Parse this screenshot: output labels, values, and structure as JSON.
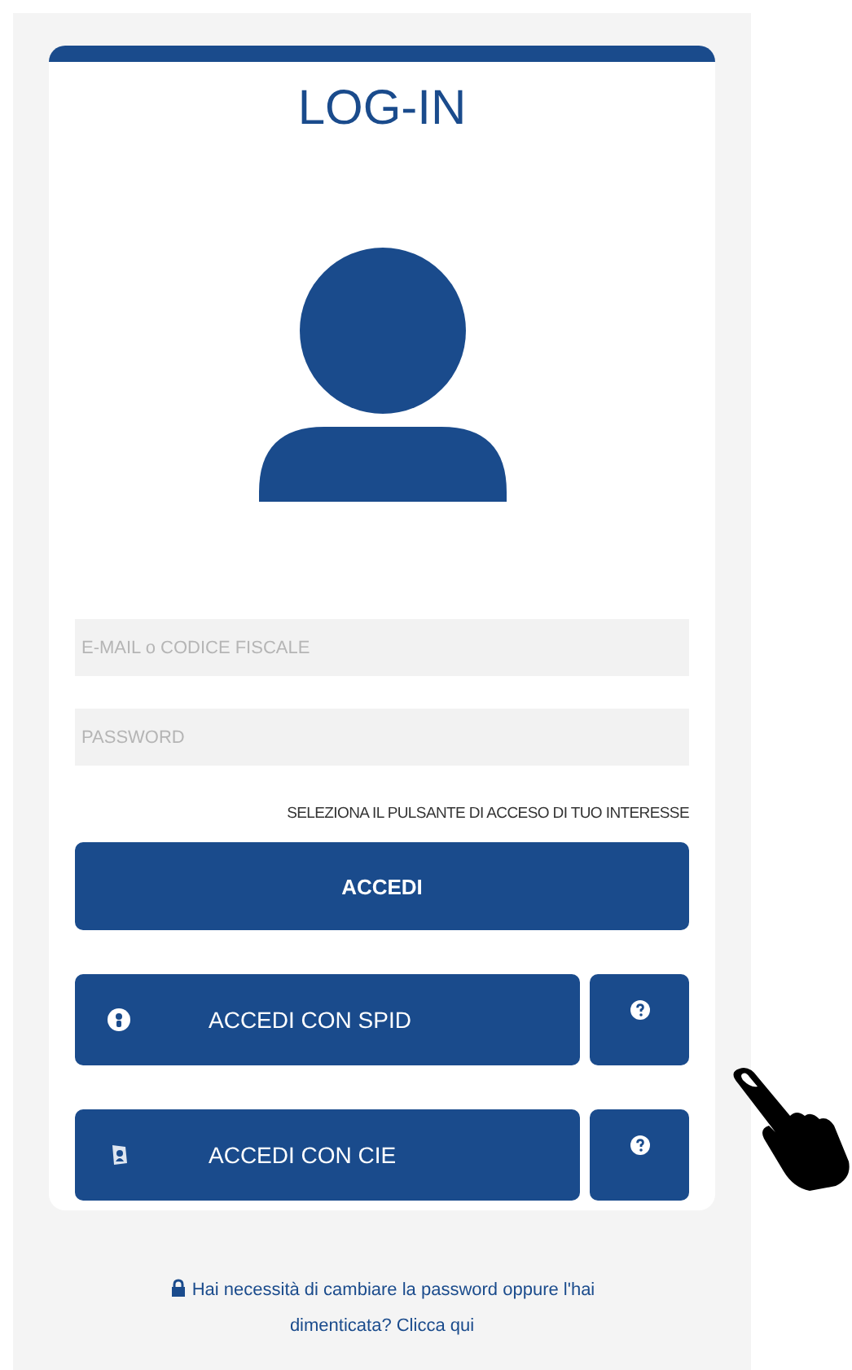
{
  "title": "LOG-IN",
  "fields": [
    {
      "placeholder": "E-MAIL o CODICE FISCALE"
    },
    {
      "placeholder": "PASSWORD"
    }
  ],
  "hint": "SELEZIONA IL PULSANTE DI ACCESO DI TUO INTERESSE",
  "primary_button": "ACCEDI",
  "login_options": [
    {
      "label": "ACCEDI CON SPID",
      "kind": "spid"
    },
    {
      "label": "ACCEDI CON CIE",
      "kind": "cie"
    }
  ],
  "footer_link": "Hai necessità di cambiare la password oppure l'hai dimenticata? Clicca qui"
}
